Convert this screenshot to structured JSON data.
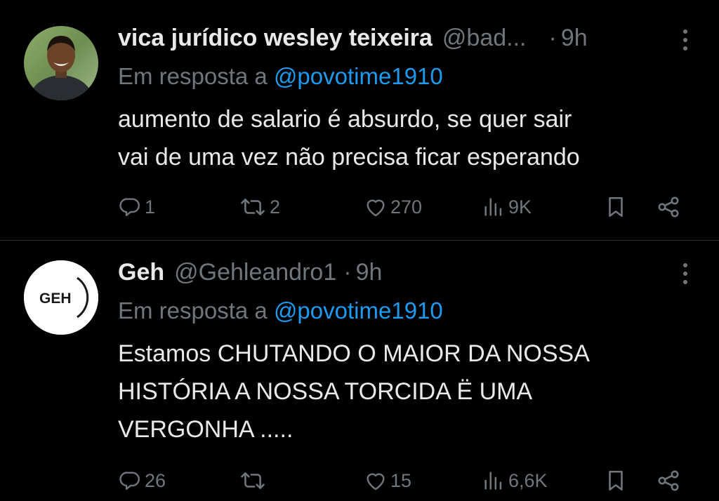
{
  "tweets": [
    {
      "author": "vica jurídico wesley teixeira",
      "handle": "@bad...",
      "separator": "·",
      "time": "9h",
      "reply_prefix": "Em resposta a",
      "reply_to": "@povotime1910",
      "text_lines": [
        "aumento de salario é absurdo, se quer sair",
        "vai de uma vez não precisa ficar esperando"
      ],
      "replies": "1",
      "reposts": "2",
      "likes": "270",
      "views": "9K"
    },
    {
      "author": "Geh",
      "handle": "@Gehleandro1",
      "separator": "·",
      "time": "9h",
      "avatar_text": "GEH",
      "reply_prefix": "Em resposta a",
      "reply_to": "@povotime1910",
      "text_lines": [
        "Estamos CHUTANDO O MAIOR DA NOSSA",
        "HISTÓRIA A NOSSA TORCIDA Ë UMA",
        "VERGONHA ....."
      ],
      "replies": "26",
      "reposts": "",
      "likes": "15",
      "views": "6,6K"
    }
  ],
  "colors": {
    "background": "#000000",
    "text": "#e7e9ea",
    "muted": "#71767b",
    "link": "#1d9bf0"
  }
}
